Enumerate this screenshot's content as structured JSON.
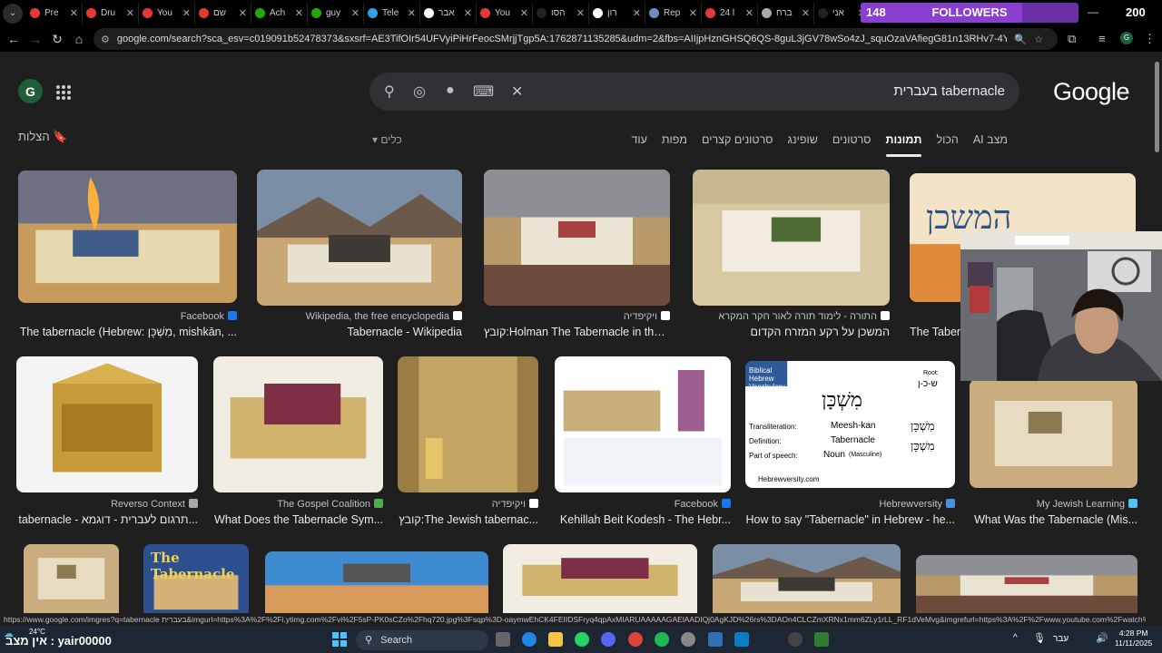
{
  "tabs": [
    {
      "label": "Pre",
      "color": "#e53935"
    },
    {
      "label": "Dru",
      "color": "#e53935"
    },
    {
      "label": "You",
      "color": "#e53935"
    },
    {
      "label": "שם",
      "color": "#e53935"
    },
    {
      "label": "Ach",
      "color": "#1faa00"
    },
    {
      "label": "guy",
      "color": "#1faa00"
    },
    {
      "label": "Tele",
      "color": "#2aa3e0"
    },
    {
      "label": "אבר",
      "color": "#ffffff"
    },
    {
      "label": "You",
      "color": "#e53935"
    },
    {
      "label": "הסו",
      "color": "#222222"
    },
    {
      "label": "רון",
      "color": "#ffffff"
    },
    {
      "label": "Rep",
      "color": "#6c8ebf"
    },
    {
      "label": "24 l",
      "color": "#e53935"
    },
    {
      "label": "ברח",
      "color": "#aaaaaa"
    },
    {
      "label": "אני",
      "color": "#222222"
    }
  ],
  "followers": {
    "current": "148",
    "label": "FOLLOWERS",
    "goal": "200",
    "progress": 0.74
  },
  "url": "google.com/search?sca_esv=c019091b52478373&sxsrf=AE3TifOIr54UFVyiPiHrFeocSMrjjTgp5A:1762871135285&udm=2&fbs=AIIjpHznGHSQ6QS-8guL3jGV78wSo4zJ_squOzaVAfiegG81n13RHv7-4YqyUudYe70Sd8cSpKbtOnlN4BQocKa...",
  "search": {
    "query": "tabernacle בעברית"
  },
  "logo": "Google",
  "saved_label": "הצלות",
  "tools_label": "כלים",
  "filters": [
    {
      "label": "מצב AI",
      "active": false
    },
    {
      "label": "הכול",
      "active": false
    },
    {
      "label": "תמונות",
      "active": true
    },
    {
      "label": "סרטונים",
      "active": false
    },
    {
      "label": "שופינג",
      "active": false
    },
    {
      "label": "סרטונים קצרים",
      "active": false
    },
    {
      "label": "מפות",
      "active": false
    },
    {
      "label": "עוד",
      "active": false
    }
  ],
  "results": [
    {
      "source": "Facebook",
      "title": "The tabernacle (Hebrew: מִשְׁכָּן, mishkān, ...",
      "rtl": false
    },
    {
      "source": "Wikipedia, the free encyclopedia",
      "title": "Tabernacle - Wikipedia",
      "rtl": false
    },
    {
      "source": "ויקיפדיה",
      "title": "קובץ:Holman The Tabernacle in the ...",
      "rtl": false
    },
    {
      "source": "התורה - לימוד תורה לאור חקר המקרא",
      "title": "המשכן על רקע המזרח הקדום",
      "rtl": true
    },
    {
      "source": "",
      "title": "The Taber",
      "rtl": false
    },
    {
      "source": "Reverso Context",
      "title": "tabernacle - תרגום לעברית - דוגמא...",
      "rtl": false
    },
    {
      "source": "The Gospel Coalition",
      "title": "What Does the Tabernacle Sym...",
      "rtl": false
    },
    {
      "source": "ויקיפדיה",
      "title": "קובץ:The Jewish tabernac...",
      "rtl": false
    },
    {
      "source": "Facebook",
      "title": "Kehillah Beit Kodesh - The Hebr...",
      "rtl": false
    },
    {
      "source": "Hebrewversity",
      "title": "How to say \"Tabernacle\" in Hebrew - he...",
      "rtl": false
    },
    {
      "source": "My Jewish Learning",
      "title": "What Was the Tabernacle (Mis...",
      "rtl": false
    }
  ],
  "image_text": {
    "hebrew_logo": "המשכן",
    "vocab_header": "Biblical Hebrew Vocabulary",
    "vocab_word": "מִשְׁכָּן",
    "vocab_root_label": "Root:",
    "vocab_root": "ש-כ-ן",
    "vocab_translit_label": "Transliteration:",
    "vocab_translit": "Meesh-kan",
    "vocab_def_label": "Definition:",
    "vocab_def": "Tabernacle",
    "vocab_pos_label": "Part of speech:",
    "vocab_pos": "Noun",
    "vocab_pos_sub": "(Masculine)",
    "vocab_site": "Hebrewversity.com",
    "book_title": "The Tabernacle"
  },
  "status_url": "https://www.google.com/imgres?q=tabernacle בעברית&imgurl=https%3A%2F%2Fi.ytimg.com%2Fvi%2F5sP-PK0sCZo%2Fhq720.jpg%3Fsqp%3D-oaymwEhCK4FEIIDSFryq4qpAxMIARUAAAAAGAElAADIQj0AgKJD%26rs%3DAOn4CLCZmXRNx1mm6ZLy1rLL_RF1dVeMvg&imgrefurl=https%3A%2F%2Fwww.youtube.com%2Fwatch%3Fv%3D5sP-PK0sCZo&doc...",
  "taskbar": {
    "user": "אין מצב : yair00000",
    "weather": "24°C",
    "search": "Search",
    "lang": "עבר",
    "time": "4:28 PM",
    "date": "11/11/2025"
  }
}
